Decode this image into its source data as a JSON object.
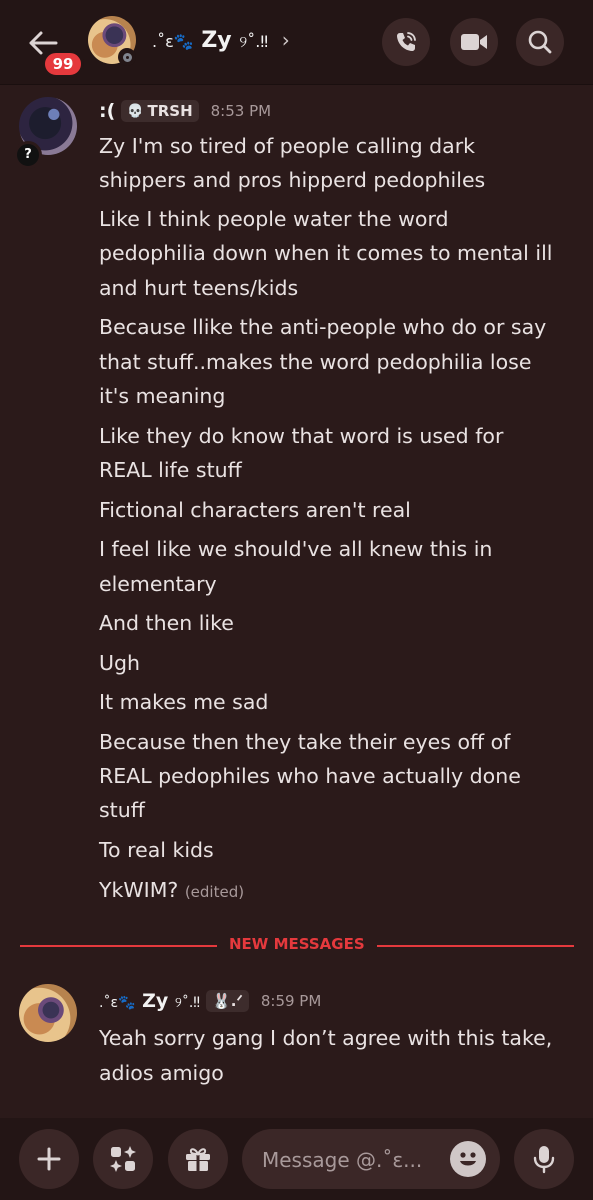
{
  "header": {
    "unread_count": "99",
    "title_prefix": ".˚ɛ🐾",
    "title_name": "Zy",
    "title_suffix": "୨˚.‼",
    "chevron": "›"
  },
  "messages": [
    {
      "author_prefix": ":(",
      "tag": "TRSH",
      "time": "8:53 PM",
      "avatar_badge": "?",
      "lines": [
        "Zy I'm so tired of people calling dark",
        "shippers and pros hipperd pedophiles",
        "Like I think people water the word",
        "pedophilia down when it comes to mental ill",
        "and hurt teens/kids",
        "Because llike the anti-people who do or say",
        "that stuff..makes the word pedophilia lose",
        "it's meaning",
        "Like they do know that word is used for",
        "REAL life stuff",
        "Fictional characters aren't real",
        "I feel like we should've all knew this in",
        "elementary",
        "And then like",
        "Ugh",
        "It makes me sad",
        "Because then they take their eyes off of",
        "REAL pedophiles who have actually done",
        "stuff",
        "To real kids",
        "YkWIM?"
      ],
      "edited_label": "(edited)"
    },
    {
      "author_prefix": ".˚ɛ🐾",
      "author_name": "Zy",
      "author_suffix": "୨˚.‼",
      "tag": "🐰.ᐟ",
      "time": "8:59 PM",
      "lines": [
        "Yeah sorry gang I don’t agree with this take,",
        "adios amigo"
      ]
    }
  ],
  "divider_label": "NEW MESSAGES",
  "composer": {
    "placeholder": "Message @.˚ɛ..."
  },
  "colors": {
    "background": "#2b1a1a",
    "accent_red": "#e5393d",
    "button_bg": "#3b2727"
  }
}
